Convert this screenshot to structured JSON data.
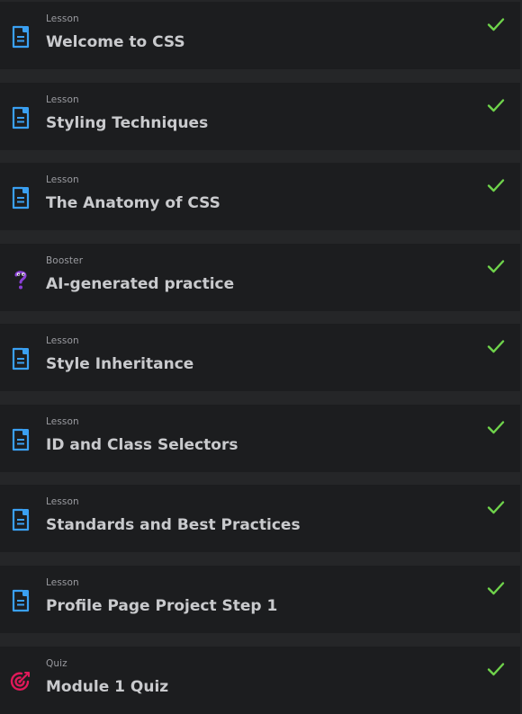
{
  "colors": {
    "row_background": "#1c1d1f",
    "page_background": "#252628",
    "lesson_icon": "#3aa0f2",
    "booster_icon": "#8a3fd6",
    "quiz_icon": "#e0195a",
    "check": "#6fd34b",
    "title_text": "#c9cacd",
    "kind_text": "#9a9ba0"
  },
  "items": [
    {
      "kind": "Lesson",
      "title": "Welcome to CSS",
      "icon": "document-icon",
      "completed": true
    },
    {
      "kind": "Lesson",
      "title": "Styling Techniques",
      "icon": "document-icon",
      "completed": true
    },
    {
      "kind": "Lesson",
      "title": "The Anatomy of CSS",
      "icon": "document-icon",
      "completed": true
    },
    {
      "kind": "Booster",
      "title": "AI-generated practice",
      "icon": "question-mark-icon",
      "completed": true
    },
    {
      "kind": "Lesson",
      "title": "Style Inheritance",
      "icon": "document-icon",
      "completed": true
    },
    {
      "kind": "Lesson",
      "title": "ID and Class Selectors",
      "icon": "document-icon",
      "completed": true
    },
    {
      "kind": "Lesson",
      "title": "Standards and Best Practices",
      "icon": "document-icon",
      "completed": true
    },
    {
      "kind": "Lesson",
      "title": "Profile Page Project Step 1",
      "icon": "document-icon",
      "completed": true
    },
    {
      "kind": "Quiz",
      "title": "Module 1 Quiz",
      "icon": "target-icon",
      "completed": true
    }
  ]
}
